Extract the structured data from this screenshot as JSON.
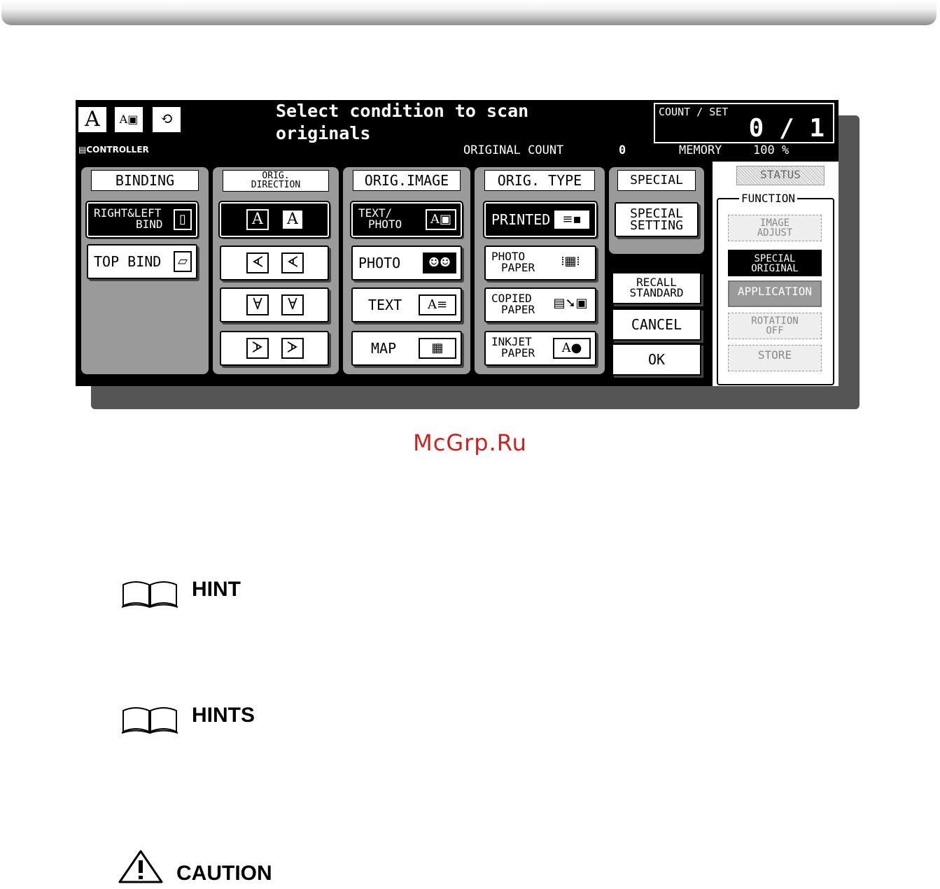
{
  "screen": {
    "title": "Select condition to scan originals",
    "mode_icons": [
      "A",
      "A▣",
      "⟲"
    ],
    "count_label": "COUNT / SET",
    "count_value": "0 / 1",
    "controller": "CONTROLLER",
    "original_count_label": "ORIGINAL COUNT",
    "original_count_value": "0",
    "memory_label": "MEMORY",
    "memory_value": "100 %"
  },
  "binding": {
    "title": "BINDING",
    "right_left_line1": "RIGHT&LEFT",
    "right_left_line2": "BIND",
    "top_bind": "TOP BIND"
  },
  "direction": {
    "title_line1": "ORIG.",
    "title_line2": "DIRECTION"
  },
  "image": {
    "title": "ORIG.IMAGE",
    "text_photo_line1": "TEXT/",
    "text_photo_line2": "PHOTO",
    "photo": "PHOTO",
    "text": "TEXT",
    "map": "MAP"
  },
  "type": {
    "title": "ORIG. TYPE",
    "printed": "PRINTED",
    "photo_paper_line1": "PHOTO",
    "photo_paper_line2": "PAPER",
    "copied_paper_line1": "COPIED",
    "copied_paper_line2": "PAPER",
    "inkjet_paper_line1": "INKJET",
    "inkjet_paper_line2": "PAPER"
  },
  "special": {
    "title": "SPECIAL",
    "setting_line1": "SPECIAL",
    "setting_line2": "SETTING",
    "recall_line1": "RECALL",
    "recall_line2": "STANDARD",
    "cancel": "CANCEL",
    "ok": "OK"
  },
  "function": {
    "status": "STATUS",
    "label": "FUNCTION",
    "image_adjust_line1": "IMAGE",
    "image_adjust_line2": "ADJUST",
    "special_original_line1": "SPECIAL",
    "special_original_line2": "ORIGINAL",
    "application": "APPLICATION",
    "rotation_line1": "ROTATION",
    "rotation_line2": "OFF",
    "store": "STORE"
  },
  "page": {
    "watermark": "McGrp.Ru",
    "hint": "HINT",
    "hints": "HINTS",
    "caution": "CAUTION"
  }
}
